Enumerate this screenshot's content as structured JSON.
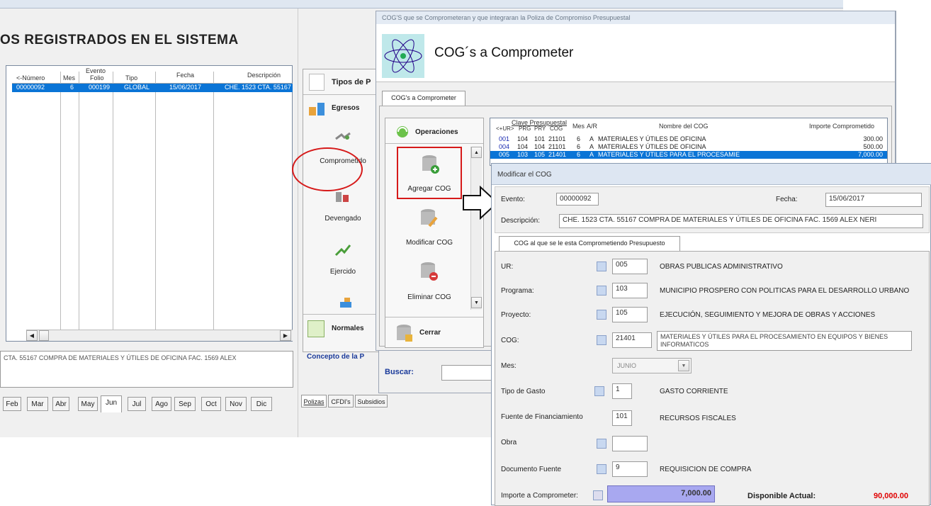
{
  "main": {
    "title": "OS REGISTRADOS EN EL SISTEMA",
    "table": {
      "group_header": "Evento",
      "headers": [
        "<-Número",
        "Mes",
        "Folio",
        "Tipo",
        "Fecha",
        "Descripción"
      ],
      "rows": [
        [
          "00000092",
          "6",
          "000199",
          "GLOBAL",
          "15/06/2017",
          "CHE. 1523 CTA. 55167"
        ]
      ]
    },
    "description_text": "CTA. 55167 COMPRA DE MATERIALES Y ÚTILES DE OFICINA FAC. 1569 ALEX",
    "months": [
      "Feb",
      "Mar",
      "Abr",
      "May",
      "Jun",
      "Jul",
      "Ago",
      "Sep",
      "Oct",
      "Nov",
      "Dic"
    ],
    "active_month": "Jun"
  },
  "middle": {
    "menu_items": [
      "Tipos de P",
      "Egresos",
      "Normales"
    ],
    "actions": [
      "Comprometido",
      "Devengado",
      "Ejercido"
    ],
    "concepto_label": "Concepto de la P",
    "bottom_tabs": [
      "Polizas",
      "CFDI's",
      "Subsidios"
    ]
  },
  "cog_window": {
    "titlebar": "COG'S que se Comprometeran y que integraran la Poliza de Compromiso Presupuestal",
    "heading": "COG´s a Comprometer",
    "tab": "COG's a Comprometer",
    "ops_title": "Operaciones",
    "ops": [
      "Agregar COG",
      "Modificar COG",
      "Eliminar COG"
    ],
    "close_label": "Cerrar",
    "search_label": "Buscar:",
    "table": {
      "group_header": "Clave Presupuestal",
      "headers": [
        "<+UR>",
        "PRG",
        "PRY",
        "COG",
        "Mes",
        "A/R",
        "Nombre del COG",
        "Importe Comprometido"
      ],
      "rows": [
        [
          "001",
          "104",
          "101",
          "21101",
          "6",
          "A",
          "MATERIALES Y ÚTILES DE OFICINA",
          "300.00"
        ],
        [
          "004",
          "104",
          "104",
          "21101",
          "6",
          "A",
          "MATERIALES Y ÚTILES DE OFICINA",
          "500.00"
        ],
        [
          "005",
          "103",
          "105",
          "21401",
          "6",
          "A",
          "MATERIALES Y ÚTILES PARA EL PROCESAMIE",
          "7,000.00"
        ]
      ]
    }
  },
  "modify_window": {
    "titlebar": "Modificar el COG",
    "evento_label": "Evento:",
    "evento_value": "00000092",
    "fecha_label": "Fecha:",
    "fecha_value": "15/06/2017",
    "desc_label": "Descripción:",
    "desc_value": "CHE. 1523 CTA. 55167 COMPRA DE MATERIALES Y ÚTILES DE OFICINA FAC. 1569 ALEX NERI",
    "tab": "COG al que se le esta Comprometiendo Presupuesto",
    "fields": {
      "ur_label": "UR:",
      "ur_value": "005",
      "ur_desc": "OBRAS PUBLICAS ADMINISTRATIVO",
      "prog_label": "Programa:",
      "prog_value": "103",
      "prog_desc": "MUNICIPIO PROSPERO CON POLITICAS PARA EL DESARROLLO URBANO",
      "proy_label": "Proyecto:",
      "proy_value": "105",
      "proy_desc": "EJECUCIÓN, SEGUIMIENTO Y MEJORA DE OBRAS Y ACCIONES",
      "cog_label": "COG:",
      "cog_value": "21401",
      "cog_desc": "MATERIALES Y ÚTILES PARA EL PROCESAMIENTO EN EQUIPOS Y BIENES INFORMATICOS",
      "mes_label": "Mes:",
      "mes_value": "JUNIO",
      "tipo_label": "Tipo de Gasto",
      "tipo_value": "1",
      "tipo_desc": "GASTO CORRIENTE",
      "fuente_label": "Fuente de Financiamiento",
      "fuente_value": "101",
      "fuente_desc": "RECURSOS FISCALES",
      "obra_label": "Obra",
      "obra_value": "",
      "doc_label": "Documento Fuente",
      "doc_value": "9",
      "doc_desc": "REQUISICION DE COMPRA",
      "importe_label": "Importe a Comprometer:",
      "importe_value": "7,000.00",
      "disp_label": "Disponible Actual:",
      "disp_value": "90,000.00"
    }
  },
  "colors": {
    "selection": "#0a74d6",
    "annotation_red": "#d61a1a",
    "disponible_red": "#e00000",
    "importe_bg": "#a8a8f0"
  }
}
